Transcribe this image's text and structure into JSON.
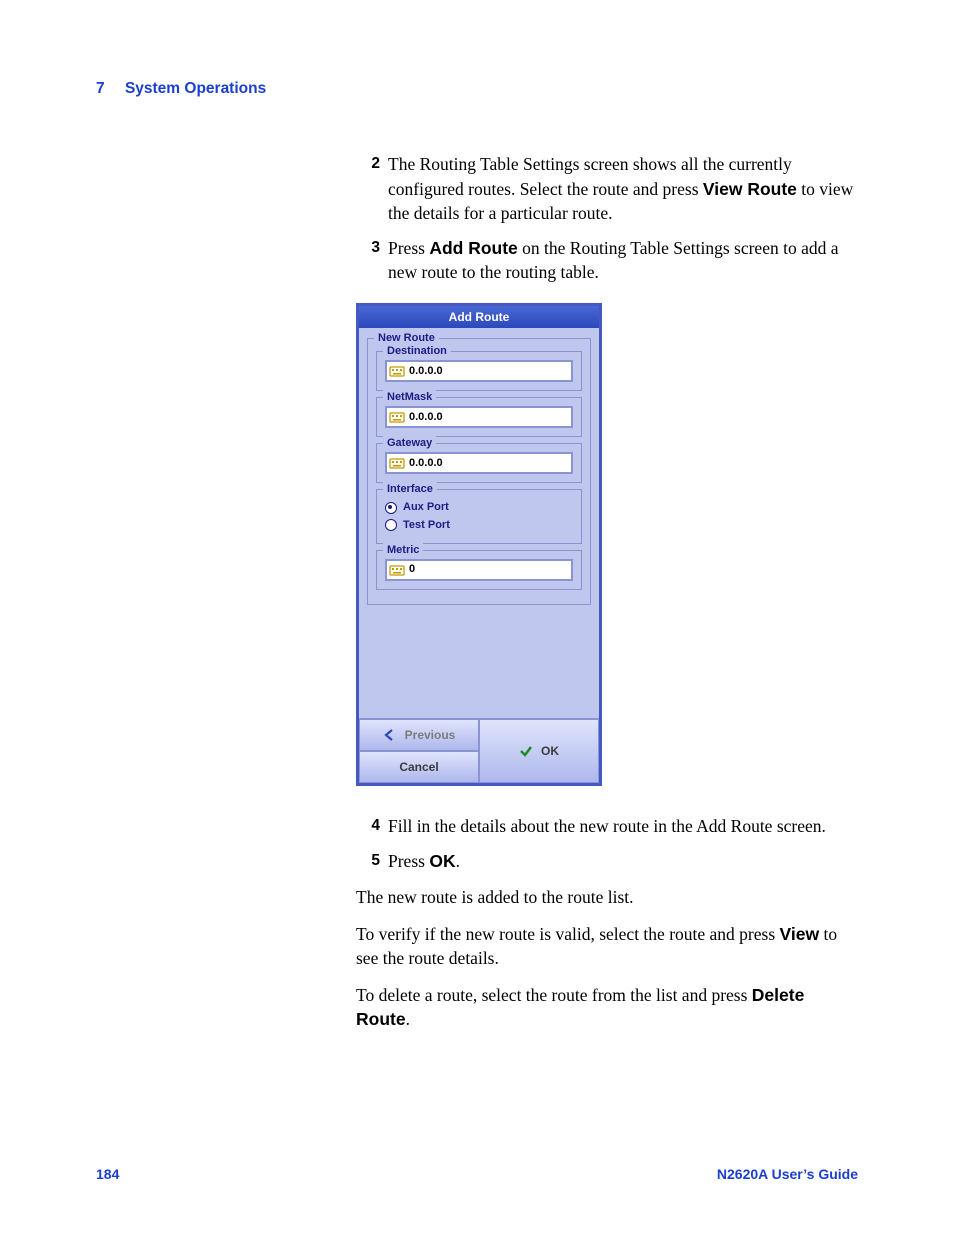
{
  "header": {
    "chapter_number": "7",
    "chapter_title": "System Operations"
  },
  "steps": {
    "s2": {
      "num": "2",
      "pre": "The Routing Table Settings screen shows all the currently configured routes. Select the route and press ",
      "bold": "View Route",
      "post": " to view the details for a particular route."
    },
    "s3": {
      "num": "3",
      "pre": "Press ",
      "bold": "Add Route",
      "post": " on the Routing Table Settings screen to add a new route to the routing table."
    },
    "s4": {
      "num": "4",
      "text": "Fill in the details about the new route in the Add Route screen."
    },
    "s5": {
      "num": "5",
      "pre": "Press ",
      "bold": "OK",
      "post": "."
    }
  },
  "body": {
    "p1": "The new route is added to the route list.",
    "p2_pre": "To verify if the new route is valid, select the route and press ",
    "p2_bold": "View",
    "p2_post": " to see the route details.",
    "p3_pre": "To delete a route, select the route from the list and press ",
    "p3_bold": "Delete Route",
    "p3_post": "."
  },
  "screenshot": {
    "title": "Add Route",
    "group": "New Route",
    "fields": {
      "destination": {
        "label": "Destination",
        "value": "0.0.0.0"
      },
      "netmask": {
        "label": "NetMask",
        "value": "0.0.0.0"
      },
      "gateway": {
        "label": "Gateway",
        "value": "0.0.0.0"
      },
      "metric": {
        "label": "Metric",
        "value": "0"
      }
    },
    "interface": {
      "label": "Interface",
      "options": [
        {
          "label": "Aux Port",
          "selected": true
        },
        {
          "label": "Test Port",
          "selected": false
        }
      ]
    },
    "buttons": {
      "previous": "Previous",
      "cancel": "Cancel",
      "ok": "OK"
    }
  },
  "footer": {
    "page": "184",
    "doc": "N2620A User’s Guide"
  }
}
